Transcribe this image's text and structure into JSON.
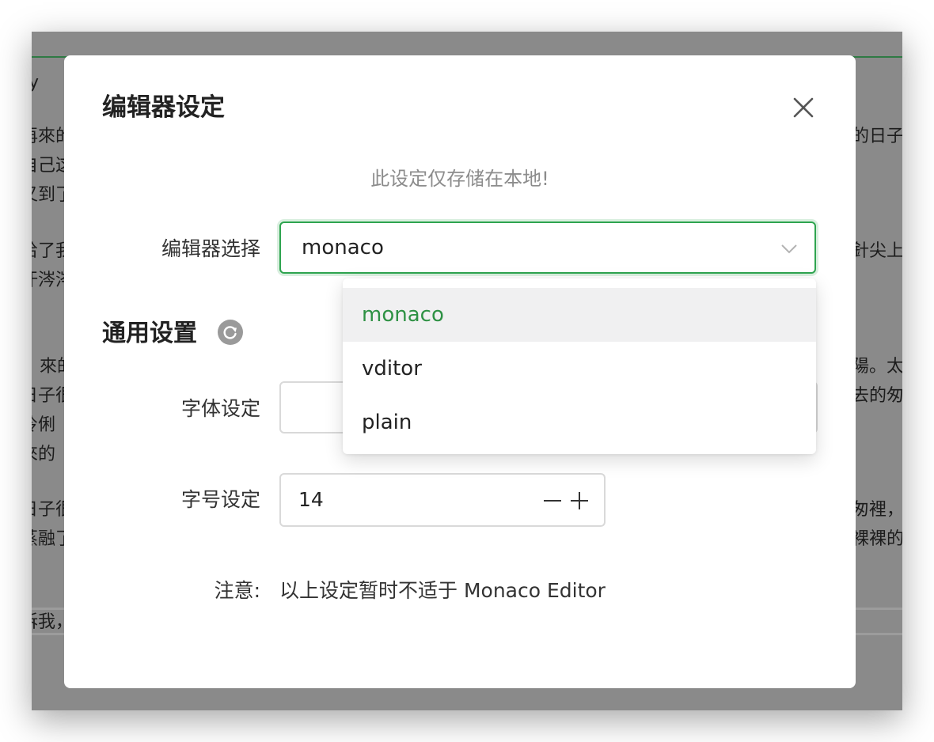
{
  "background": {
    "left_fragments": [
      "y",
      "再來的",
      "自己这",
      "又到了",
      "给了我",
      "汗涔涔",
      "來的",
      "日子很",
      "伶俐",
      "來的",
      "日子很",
      "蒸融了",
      "訴我，"
    ],
    "right_fragments": [
      "的日子",
      "針尖上",
      "陽。太",
      "去的匆",
      "匆裡，",
      "裸裸的"
    ]
  },
  "modal": {
    "title": "编辑器设定",
    "notice": "此设定仅存储在本地!",
    "editor_select": {
      "label": "编辑器选择",
      "value": "monaco",
      "options": [
        "monaco",
        "vditor",
        "plain"
      ],
      "active_option": "monaco"
    },
    "general": {
      "title": "通用设置",
      "font_family_label": "字体设定",
      "font_size_label": "字号设定",
      "font_size_value": "14"
    },
    "note": {
      "label": "注意:",
      "text": "以上设定暂时不适于 Monaco Editor"
    }
  },
  "colors": {
    "accent": "#2ea44f",
    "active_option_text": "#2e9144",
    "active_option_bg": "#f0f0f1",
    "overlay": "#8a8a8a"
  },
  "icons": {
    "close": "close-icon",
    "select_arrow": "chevron-down-icon",
    "refresh": "refresh-icon",
    "minus": "minus-icon",
    "plus": "plus-icon"
  }
}
